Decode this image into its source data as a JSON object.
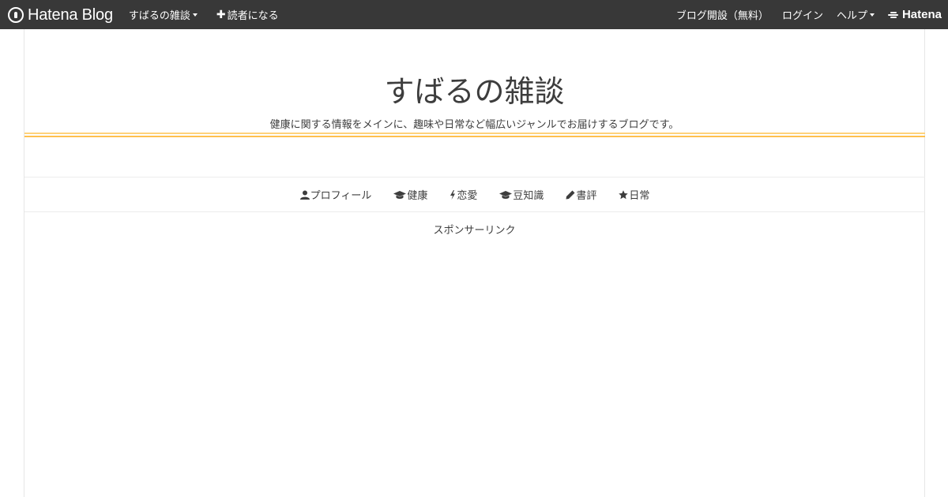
{
  "globalbar": {
    "logo_text": "Hatena Blog",
    "blog_menu_label": "すばるの雑談",
    "subscribe_label": "読者になる",
    "create_blog_label": "ブログ開設（無料）",
    "login_label": "ログイン",
    "help_label": "ヘルプ",
    "hatena_logo_text": "Hatena",
    "background_color": "#383838"
  },
  "header": {
    "title": "すばるの雑談",
    "description": "健康に関する情報をメインに、趣味や日常など幅広いジャンルでお届けするブログです。",
    "accent_color": "#ffc04d"
  },
  "nav": {
    "items": [
      {
        "icon": "user-icon",
        "label": "プロフィール"
      },
      {
        "icon": "graduation-cap-icon",
        "label": "健康"
      },
      {
        "icon": "bolt-icon",
        "label": "恋愛"
      },
      {
        "icon": "graduation-cap-icon",
        "label": "豆知識"
      },
      {
        "icon": "pencil-icon",
        "label": "書評"
      },
      {
        "icon": "star-icon",
        "label": "日常"
      }
    ]
  },
  "main": {
    "sponsored_label": "スポンサーリンク"
  }
}
